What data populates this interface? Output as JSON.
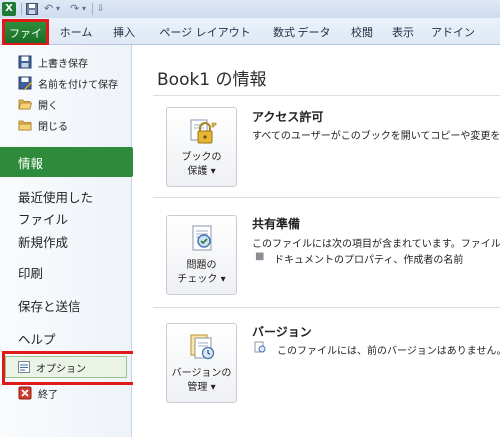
{
  "qat": {
    "logo": "X",
    "save_icon": "save-icon",
    "undo": "↶",
    "redo": "↷",
    "customize": "⇩"
  },
  "tabs": [
    {
      "label": "ファイル"
    },
    {
      "label": "ホーム"
    },
    {
      "label": "挿入"
    },
    {
      "label": "ページ レイアウト"
    },
    {
      "label": "数式"
    },
    {
      "label": "データ"
    },
    {
      "label": "校閲"
    },
    {
      "label": "表示"
    },
    {
      "label": "アドイン"
    }
  ],
  "nav": {
    "commands": [
      {
        "label": "上書き保存",
        "icon": "save-icon"
      },
      {
        "label": "名前を付けて保存",
        "icon": "save-as-icon"
      },
      {
        "label": "開く",
        "icon": "open-folder-icon"
      },
      {
        "label": "閉じる",
        "icon": "close-folder-icon"
      }
    ],
    "tabs": [
      {
        "label": "情報"
      },
      {
        "label": "最近使用した"
      },
      {
        "label": "ファイル"
      },
      {
        "label": "新規作成"
      },
      {
        "label": "印刷"
      },
      {
        "label": "保存と送信"
      },
      {
        "label": "ヘルプ"
      }
    ],
    "options": {
      "label": "オプション",
      "icon": "options-icon"
    },
    "exit": {
      "label": "終了",
      "icon": "exit-icon"
    }
  },
  "main": {
    "title": "Book1 の情報",
    "sections": [
      {
        "button_line1": "ブックの",
        "button_line2": "保護 ▾",
        "title": "アクセス許可",
        "desc": "すべてのユーザーがこのブックを開いてコピーや変更を行う"
      },
      {
        "button_line1": "問題の",
        "button_line2": "チェック ▾",
        "title": "共有準備",
        "desc": "このファイルには次の項目が含まれています。ファイルの共",
        "bullet": "ドキュメントのプロパティ、作成者の名前"
      },
      {
        "button_line1": "バージョンの",
        "button_line2": "管理 ▾",
        "title": "バージョン",
        "desc": "このファイルには、前のバージョンはありません。"
      }
    ]
  },
  "colors": {
    "file_tab": "#1f7a2e",
    "highlight": "#e01919",
    "active_nav": "#2e8b3b"
  }
}
